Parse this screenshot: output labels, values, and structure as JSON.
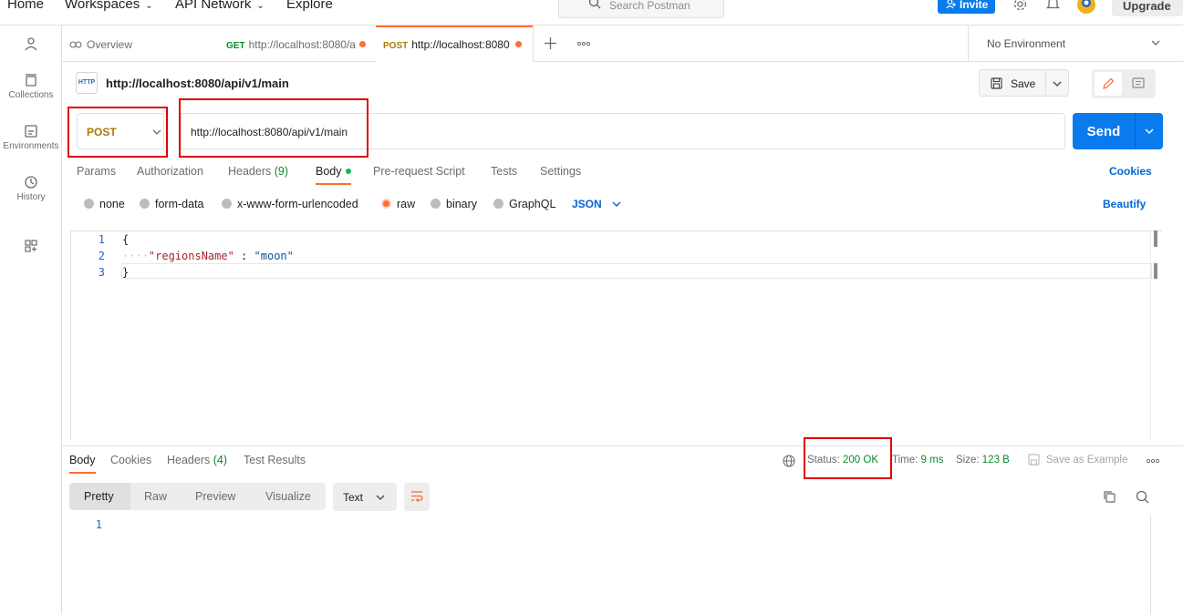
{
  "topnav": {
    "home": "Home",
    "workspaces": "Workspaces",
    "api_network": "API Network",
    "explore": "Explore",
    "search_placeholder": "Search Postman",
    "invite": "Invite",
    "upgrade": "Upgrade"
  },
  "sidebar": {
    "items": [
      {
        "label": "",
        "icon": "user-icon"
      },
      {
        "label": "Collections",
        "icon": "collections-icon"
      },
      {
        "label": "Environments",
        "icon": "environments-icon"
      },
      {
        "label": "History",
        "icon": "history-icon"
      },
      {
        "label": "",
        "icon": "new-grid-icon"
      }
    ]
  },
  "tabs": [
    {
      "method": "",
      "label": "Overview"
    },
    {
      "method": "GET",
      "label": "http://localhost:8080/a"
    },
    {
      "method": "POST",
      "label": "http://localhost:8080"
    }
  ],
  "environment": "No Environment",
  "request": {
    "title": "http://localhost:8080/api/v1/main",
    "save_label": "Save",
    "method": "POST",
    "url": "http://localhost:8080/api/v1/main",
    "send_label": "Send",
    "tabs": {
      "params": "Params",
      "authorization": "Authorization",
      "headers": "Headers",
      "headers_count": "(9)",
      "body": "Body",
      "prerequest": "Pre-request Script",
      "tests": "Tests",
      "settings": "Settings"
    },
    "cookies_link": "Cookies",
    "body_types": [
      "none",
      "form-data",
      "x-www-form-urlencoded",
      "raw",
      "binary",
      "GraphQL"
    ],
    "selected_body_type": "raw",
    "raw_format": "JSON",
    "beautify": "Beautify",
    "code": {
      "line_numbers": [
        "1",
        "2",
        "3"
      ],
      "open_brace": "{",
      "indent": "····",
      "key": "\"regionsName\"",
      "sep": " : ",
      "value": "\"moon\"",
      "close_brace": "}"
    }
  },
  "response": {
    "tabs": {
      "body": "Body",
      "cookies": "Cookies",
      "headers": "Headers",
      "headers_count": "(4)",
      "test_results": "Test Results"
    },
    "status_label": "Status:",
    "status_value": "200 OK",
    "time_label": "Time:",
    "time_value": "9 ms",
    "size_label": "Size:",
    "size_value": "123 B",
    "save_example": "Save as Example",
    "views": [
      "Pretty",
      "Raw",
      "Preview",
      "Visualize"
    ],
    "format": "Text",
    "line_numbers": [
      "1"
    ]
  },
  "colors": {
    "accent": "#ff6c37",
    "send_blue": "#097bed",
    "post_method": "#ad7a03",
    "get_method": "#0a8a2d",
    "status_ok": "#0a8a2d",
    "highlight_box": "#e00000"
  }
}
